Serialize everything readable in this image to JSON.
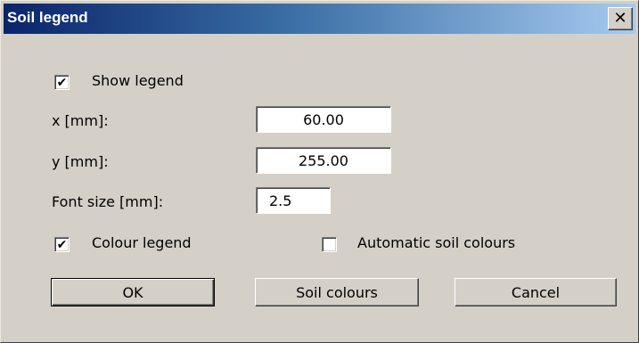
{
  "dialog": {
    "title": "Soil legend",
    "close_icon": "close-icon"
  },
  "show_legend": {
    "label": "Show legend",
    "checked": true
  },
  "fields": {
    "x": {
      "label": "x [mm]:",
      "value": "60.00"
    },
    "y": {
      "label": "y [mm]:",
      "value": "255.00"
    },
    "font_size": {
      "label": "Font size [mm]:",
      "value": "2.5"
    }
  },
  "colour_legend": {
    "label": "Colour legend",
    "checked": true
  },
  "automatic_soil_colours": {
    "label": "Automatic soil colours",
    "checked": false
  },
  "buttons": {
    "ok": "OK",
    "soil_colours": "Soil colours",
    "cancel": "Cancel"
  },
  "glyphs": {
    "check": "✔",
    "close": "✕"
  }
}
